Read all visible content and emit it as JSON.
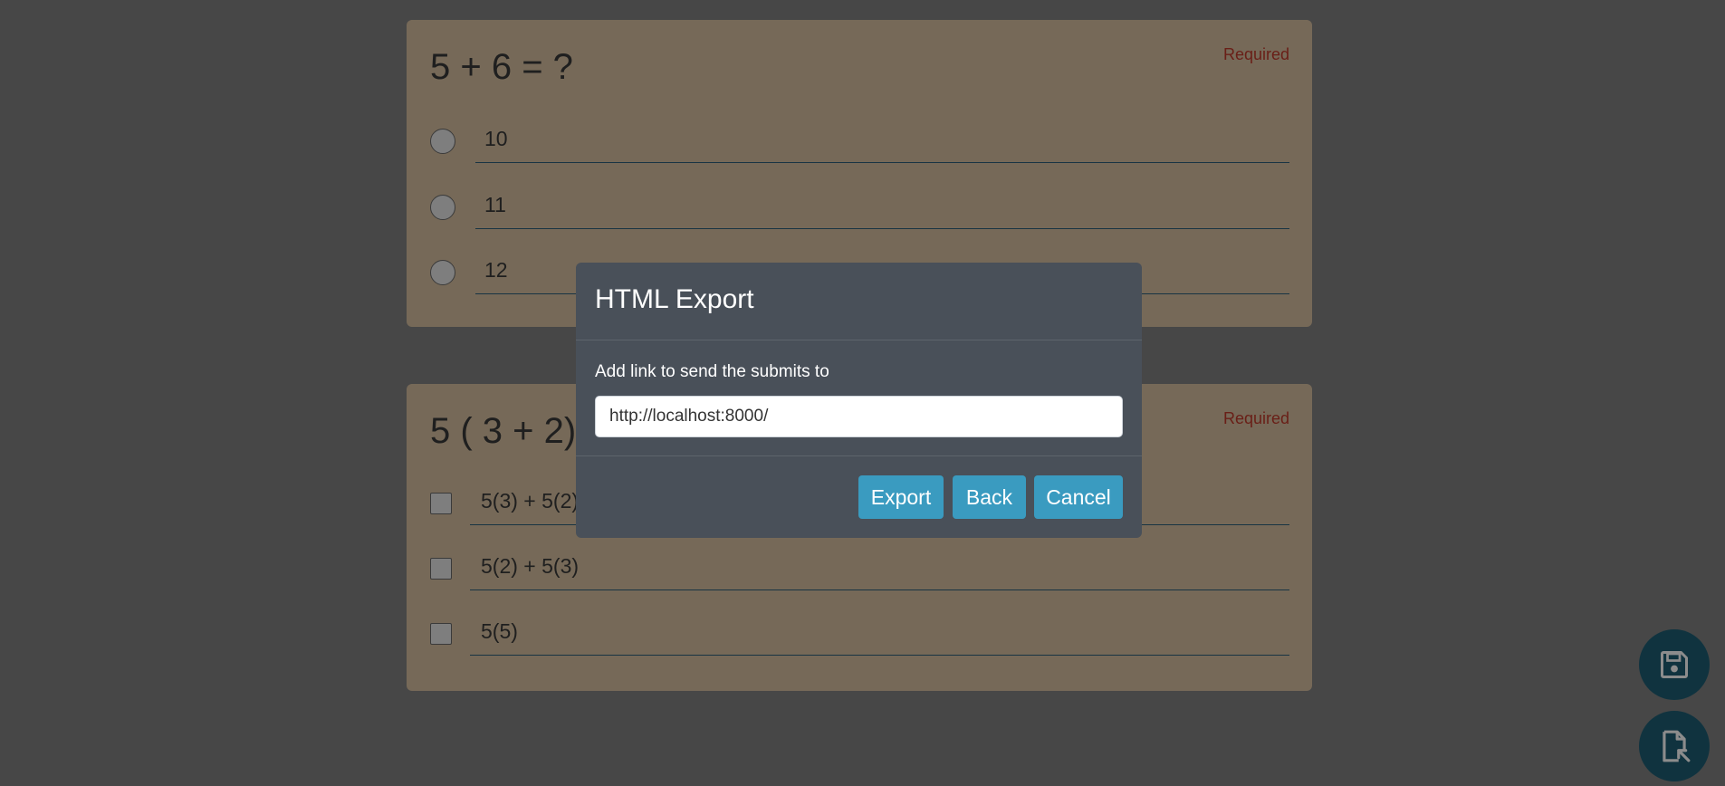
{
  "questions": [
    {
      "title": "5 + 6 = ?",
      "required_label": "Required",
      "type": "radio",
      "options": [
        "10",
        "11",
        "12"
      ]
    },
    {
      "title": "5 ( 3 + 2) =",
      "required_label": "Required",
      "type": "checkbox",
      "options": [
        "5(3) + 5(2)",
        "5(2) + 5(3)",
        "5(5)"
      ]
    }
  ],
  "modal": {
    "title": "HTML Export",
    "label": "Add link to send the submits to",
    "input_value": "http://localhost:8000/",
    "buttons": {
      "export": "Export",
      "back": "Back",
      "cancel": "Cancel"
    }
  },
  "fabs": {
    "save_icon": "floppy-disk-icon",
    "export_icon": "file-export-icon"
  },
  "colors": {
    "card_bg": "#d7c0a0",
    "required": "#c0392b",
    "modal_bg": "#495059",
    "button": "#3a9bc0",
    "fab": "#1e5e73"
  }
}
